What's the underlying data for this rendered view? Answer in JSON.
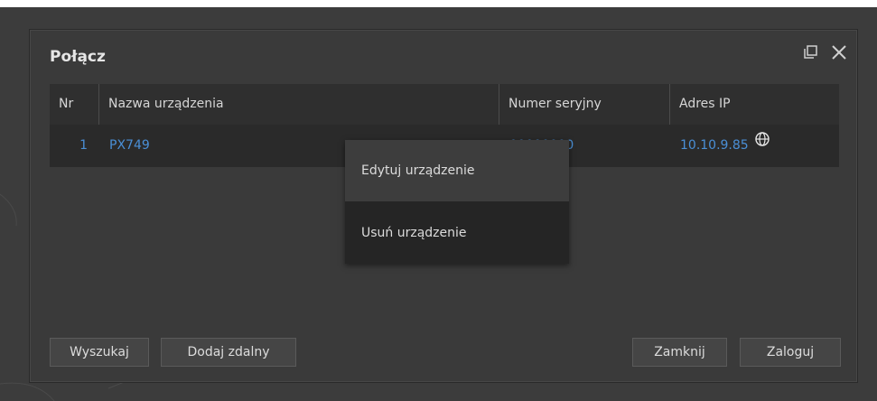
{
  "dialog": {
    "title": "Połącz",
    "restore_icon": "restore-window-icon",
    "close_icon": "close-icon"
  },
  "table": {
    "headers": [
      "Nr",
      "Nazwa urządzenia",
      "Numer seryjny",
      "Adres IP"
    ],
    "rows": [
      {
        "nr": "1",
        "name": "PX749",
        "serial": "00000000",
        "ip": "10.10.9.85",
        "ip_icon": "globe-icon"
      }
    ]
  },
  "context_menu": {
    "items": [
      "Edytuj urządzenie",
      "Usuń urządzenie"
    ]
  },
  "buttons": {
    "search": "Wyszukaj",
    "add_remote": "Dodaj zdalny",
    "close": "Zamknij",
    "login": "Zaloguj"
  },
  "colors": {
    "link": "#4a8fd6",
    "background": "#3c3c3c",
    "panel": "#3a3a3a"
  }
}
